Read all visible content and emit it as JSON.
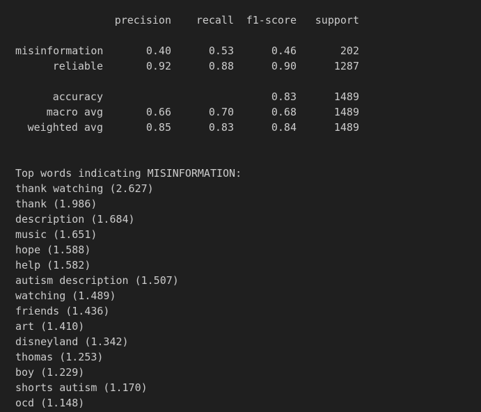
{
  "report": {
    "headers": {
      "precision": "precision",
      "recall": "recall",
      "f1": "f1-score",
      "support": "support"
    },
    "rows": [
      {
        "label": "misinformation",
        "precision": "0.40",
        "recall": "0.53",
        "f1": "0.46",
        "support": "202"
      },
      {
        "label": "reliable",
        "precision": "0.92",
        "recall": "0.88",
        "f1": "0.90",
        "support": "1287"
      }
    ],
    "summary": [
      {
        "label": "accuracy",
        "precision": "",
        "recall": "",
        "f1": "0.83",
        "support": "1489"
      },
      {
        "label": "macro avg",
        "precision": "0.66",
        "recall": "0.70",
        "f1": "0.68",
        "support": "1489"
      },
      {
        "label": "weighted avg",
        "precision": "0.85",
        "recall": "0.83",
        "f1": "0.84",
        "support": "1489"
      }
    ]
  },
  "top_words": {
    "heading": "Top words indicating MISINFORMATION:",
    "items": [
      "thank watching (2.627)",
      "thank (1.986)",
      "description (1.684)",
      "music (1.651)",
      "hope (1.588)",
      "help (1.582)",
      "autism description (1.507)",
      "watching (1.489)",
      "friends (1.436)",
      "art (1.410)",
      "disneyland (1.342)",
      "thomas (1.253)",
      "boy (1.229)",
      "shorts autism (1.170)",
      "ocd (1.148)"
    ]
  },
  "colors": {
    "background": "#1f1f1f",
    "text": "#cccccc"
  }
}
